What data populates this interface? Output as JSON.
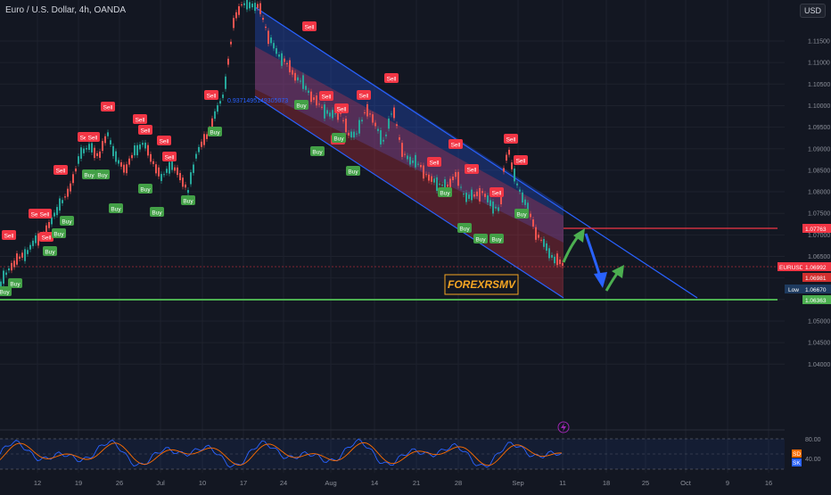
{
  "header": {
    "title": "Euro / U.S. Dollar, 4h, OANDA",
    "currency_button": "USD"
  },
  "fib_label": "0.9371495149305073",
  "watermark": "FOREXRSMV",
  "price_axis": {
    "ticks": [
      "1.11500",
      "1.11000",
      "1.10500",
      "1.10000",
      "1.09500",
      "1.09000",
      "1.08500",
      "1.08000",
      "1.07500",
      "1.07000",
      "1.06500",
      "1.06000",
      "1.05500",
      "1.05000",
      "1.04500",
      "1.04000"
    ],
    "badges": {
      "resistance": "1.07763",
      "symbol": "EURUSD",
      "current": "1.06992",
      "prev": "1.06981",
      "low_label": "Low",
      "low": "1.06670",
      "support": "1.06363"
    }
  },
  "time_axis": {
    "labels": [
      "12",
      "19",
      "26",
      "Jul",
      "10",
      "17",
      "24",
      "Aug",
      "14",
      "21",
      "28",
      "Sep",
      "11",
      "18",
      "25",
      "Oct",
      "9",
      "16"
    ]
  },
  "oscillator": {
    "upper": "80.00",
    "mid": "40.00",
    "k_badge": "SD",
    "d_badge": "SK"
  },
  "signals": {
    "buy_label": "Buy",
    "sell_label": "Sell"
  },
  "colors": {
    "background": "#131722",
    "up": "#26a69a",
    "down": "#ef5350",
    "channel_line": "#2962ff",
    "resistance": "#f23645",
    "support": "#4caf50",
    "watermark": "#f5a623"
  },
  "icons": {
    "bolt": "lightning-icon",
    "arrow_up": "green-up-arrow-icon",
    "arrow_down": "blue-down-arrow-icon"
  }
}
